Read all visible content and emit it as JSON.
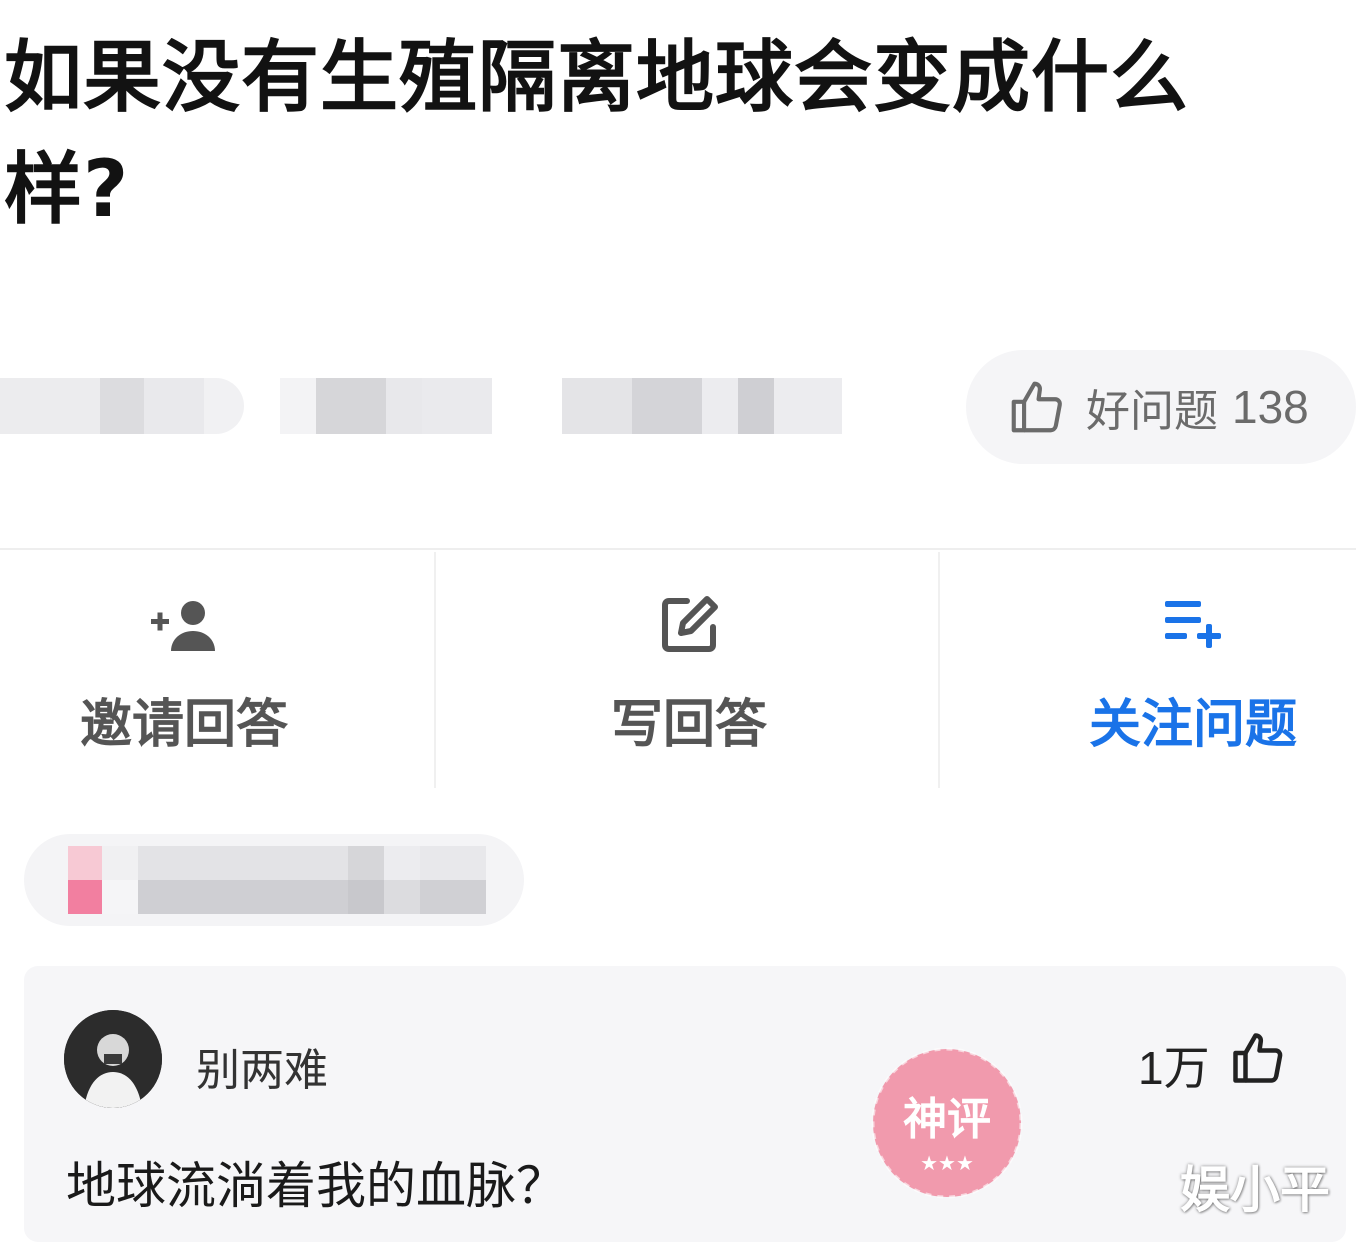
{
  "question": {
    "title": "如果没有生殖隔离地球会变成什么样?"
  },
  "good_question": {
    "label": "好问题",
    "count": "138"
  },
  "actions": {
    "invite": {
      "label": "邀请回答",
      "icon": "add-user-icon"
    },
    "write": {
      "label": "写回答",
      "icon": "edit-icon"
    },
    "follow": {
      "label": "关注问题",
      "icon": "add-list-icon"
    }
  },
  "answer": {
    "author": "别两难",
    "likes": "1万",
    "text": "地球流淌着我的血脉？",
    "stamp_label": "神评"
  },
  "watermark": "娱小平",
  "colors": {
    "accent_blue": "#1a73e8",
    "stamp_pink": "#f08aa0",
    "muted_gray": "#6b6b6b"
  }
}
